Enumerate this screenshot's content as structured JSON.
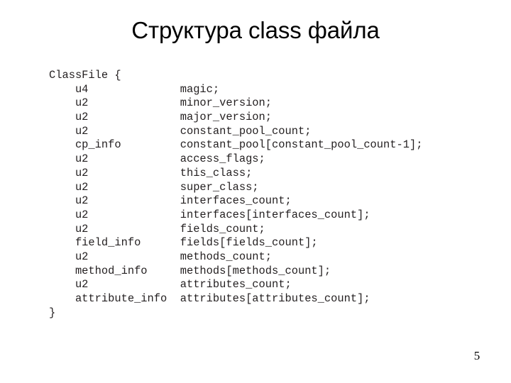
{
  "slide": {
    "title": "Структура class файла",
    "page_number": "5",
    "background_color": "#ffffff",
    "text_color": "#231f20"
  },
  "code": {
    "language": "java-classfile-spec",
    "open_line": "ClassFile {",
    "close_line": "}",
    "indent": "    ",
    "name_column": 20,
    "members": [
      {
        "type": "u4",
        "name": "magic;"
      },
      {
        "type": "u2",
        "name": "minor_version;"
      },
      {
        "type": "u2",
        "name": "major_version;"
      },
      {
        "type": "u2",
        "name": "constant_pool_count;"
      },
      {
        "type": "cp_info",
        "name": "constant_pool[constant_pool_count-1];"
      },
      {
        "type": "u2",
        "name": "access_flags;"
      },
      {
        "type": "u2",
        "name": "this_class;"
      },
      {
        "type": "u2",
        "name": "super_class;"
      },
      {
        "type": "u2",
        "name": "interfaces_count;"
      },
      {
        "type": "u2",
        "name": "interfaces[interfaces_count];"
      },
      {
        "type": "u2",
        "name": "fields_count;"
      },
      {
        "type": "field_info",
        "name": "fields[fields_count];"
      },
      {
        "type": "u2",
        "name": "methods_count;"
      },
      {
        "type": "method_info",
        "name": "methods[methods_count];"
      },
      {
        "type": "u2",
        "name": "attributes_count;"
      },
      {
        "type": "attribute_info",
        "name": "attributes[attributes_count];"
      }
    ]
  }
}
